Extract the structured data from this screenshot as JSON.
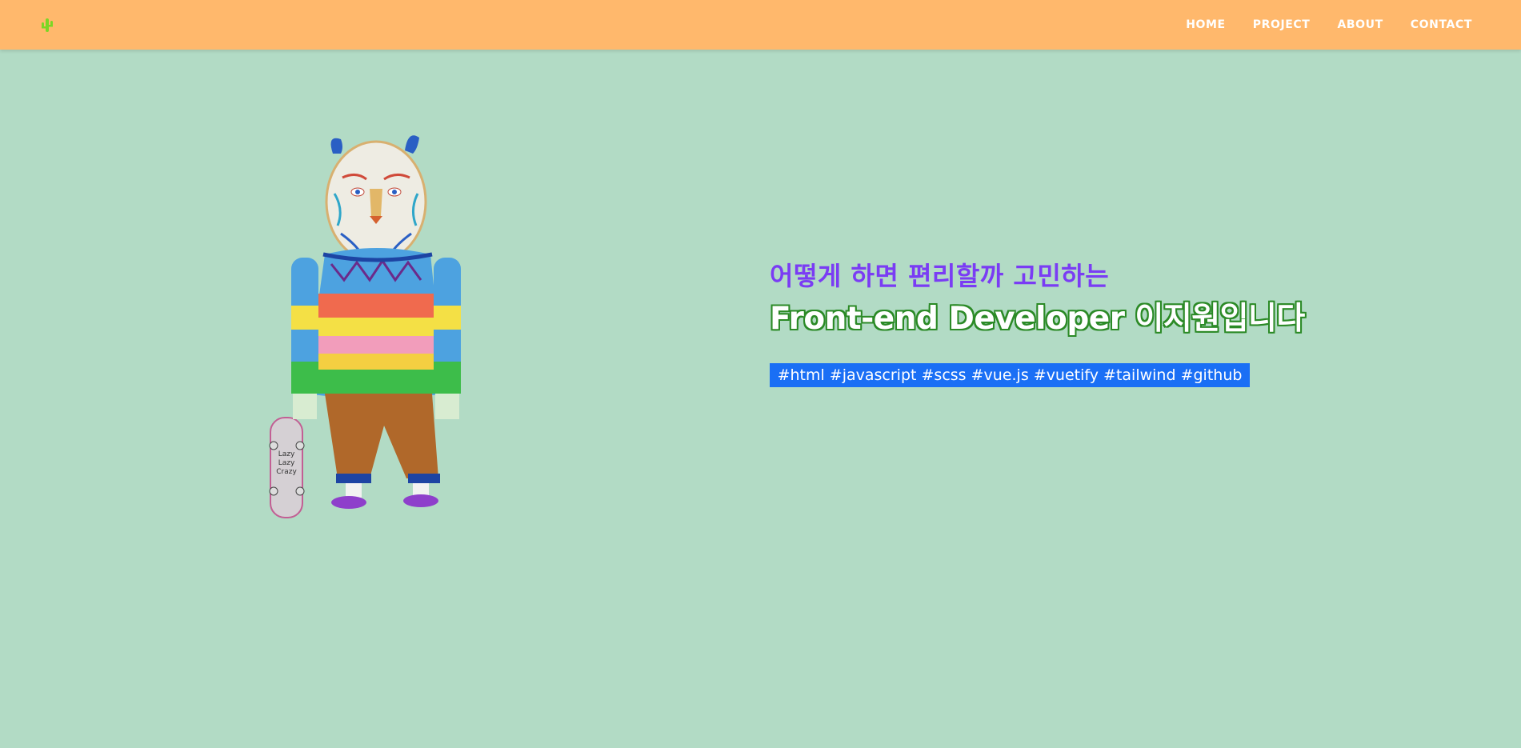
{
  "header": {
    "logo_icon": "cactus-icon",
    "nav": [
      {
        "label": "HOME"
      },
      {
        "label": "PROJECT"
      },
      {
        "label": "ABOUT"
      },
      {
        "label": "CONTACT"
      }
    ]
  },
  "hero": {
    "illustration": "tiger-in-sweater-with-skateboard",
    "skateboard_text": [
      "Lazy",
      "Lazy",
      "Crazy"
    ],
    "subtitle": "어떻게 하면 편리할까 고민하는",
    "headline": "Front-end Developer 이지원입니다",
    "tags": "#html #javascript #scss #vue.js #vuetify #tailwind #github"
  },
  "colors": {
    "background": "#b2dbc5",
    "header": "#ffb86c",
    "subtitle": "#7a3cf4",
    "headline_outline": "#2b8a26",
    "tags_bg": "#1a6ff5"
  }
}
